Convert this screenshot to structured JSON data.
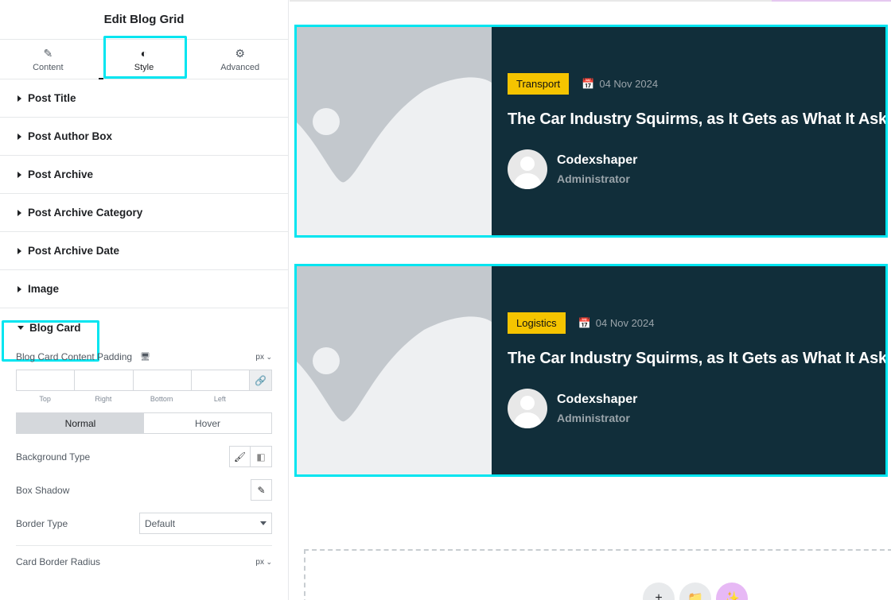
{
  "panel": {
    "title": "Edit Blog Grid",
    "tabs": [
      {
        "label": "Content",
        "icon": "pencil-icon"
      },
      {
        "label": "Style",
        "icon": "contrast-icon"
      },
      {
        "label": "Advanced",
        "icon": "gear-icon"
      }
    ],
    "active_tab": "Style",
    "sections": [
      {
        "label": "Post Title"
      },
      {
        "label": "Post Author Box"
      },
      {
        "label": "Post Archive"
      },
      {
        "label": "Post Archive Category"
      },
      {
        "label": "Post Archive Date"
      },
      {
        "label": "Image"
      },
      {
        "label": "Blog Card",
        "open": true
      }
    ],
    "blog_card": {
      "padding_label": "Blog Card Content Padding",
      "unit": "px",
      "dim_labels": [
        "Top",
        "Right",
        "Bottom",
        "Left"
      ],
      "state_tabs": [
        "Normal",
        "Hover"
      ],
      "background_type_label": "Background Type",
      "box_shadow_label": "Box Shadow",
      "border_type_label": "Border Type",
      "border_type_value": "Default",
      "radius_label": "Card Border Radius",
      "radius_unit": "px"
    }
  },
  "preview": {
    "cards": [
      {
        "category": "Transport",
        "date": "04 Nov 2024",
        "title": "The Car Industry Squirms, as It Gets as What It Asked",
        "author": "Codexshaper",
        "role": "Administrator"
      },
      {
        "category": "Logistics",
        "date": "04 Nov 2024",
        "title": "The Car Industry Squirms, as It Gets as What It Asked",
        "author": "Codexshaper",
        "role": "Administrator"
      }
    ],
    "add_buttons": [
      {
        "icon": "plus-icon"
      },
      {
        "icon": "folder-icon"
      },
      {
        "icon": "ai-sparkle-icon"
      }
    ],
    "colors": {
      "card_bg": "#112e3a",
      "badge": "#f5c400",
      "highlight": "#00e5f0"
    }
  }
}
